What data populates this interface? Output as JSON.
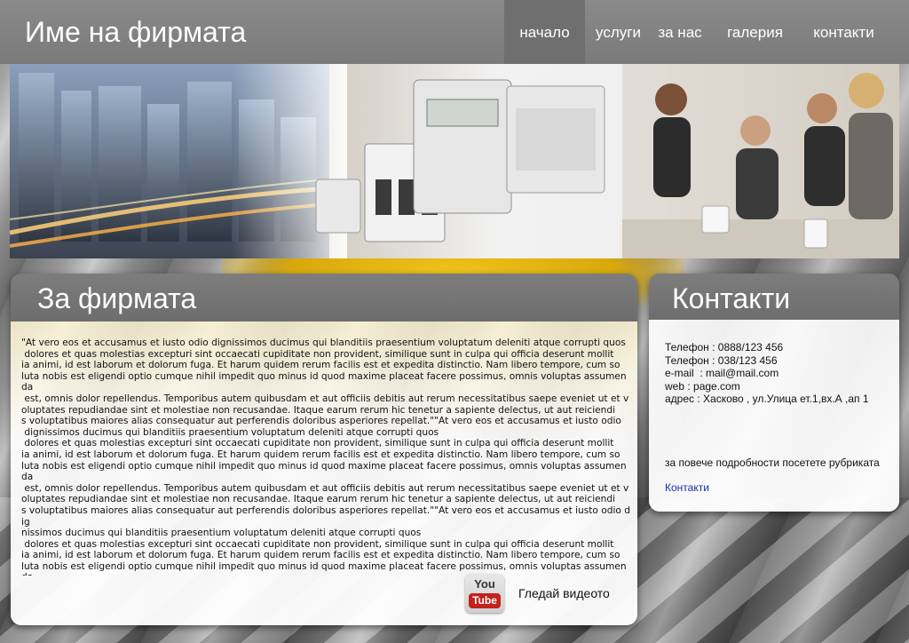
{
  "header": {
    "company_name": "Име на фирмата",
    "nav": [
      {
        "label": "начало",
        "active": true
      },
      {
        "label": "услуги",
        "active": false
      },
      {
        "label": "за нас",
        "active": false
      },
      {
        "label": "галерия",
        "active": false
      },
      {
        "label": "контакти",
        "active": false
      }
    ]
  },
  "about": {
    "title": "За фирмата",
    "text": "\"At vero eos et accusamus et iusto odio dignissimos ducimus qui blanditiis praesentium voluptatum deleniti atque corrupti quos\n dolores et quas molestias excepturi sint occaecati cupiditate non provident, similique sunt in culpa qui officia deserunt mollit\nia animi, id est laborum et dolorum fuga. Et harum quidem rerum facilis est et expedita distinctio. Nam libero tempore, cum so\nluta nobis est eligendi optio cumque nihil impedit quo minus id quod maxime placeat facere possimus, omnis voluptas assumenda\n est, omnis dolor repellendus. Temporibus autem quibusdam et aut officiis debitis aut rerum necessitatibus saepe eveniet ut et v\noluptates repudiandae sint et molestiae non recusandae. Itaque earum rerum hic tenetur a sapiente delectus, ut aut reiciendi\ns voluptatibus maiores alias consequatur aut perferendis doloribus asperiores repellat.\"\"At vero eos et accusamus et iusto odio\n dignissimos ducimus qui blanditiis praesentium voluptatum deleniti atque corrupti quos\n dolores et quas molestias excepturi sint occaecati cupiditate non provident, similique sunt in culpa qui officia deserunt mollit\nia animi, id est laborum et dolorum fuga. Et harum quidem rerum facilis est et expedita distinctio. Nam libero tempore, cum so\nluta nobis est eligendi optio cumque nihil impedit quo minus id quod maxime placeat facere possimus, omnis voluptas assumenda\n est, omnis dolor repellendus. Temporibus autem quibusdam et aut officiis debitis aut rerum necessitatibus saepe eveniet ut et v\noluptates repudiandae sint et molestiae non recusandae. Itaque earum rerum hic tenetur a sapiente delectus, ut aut reiciendi\ns voluptatibus maiores alias consequatur aut perferendis doloribus asperiores repellat.\"\"At vero eos et accusamus et iusto odio dig\nnissimos ducimus qui blanditiis praesentium voluptatum deleniti atque corrupti quos\n dolores et quas molestias excepturi sint occaecati cupiditate non provident, similique sunt in culpa qui officia deserunt mollit\nia animi, id est laborum et dolorum fuga. Et harum quidem rerum facilis est et expedita distinctio. Nam libero tempore, cum so\nluta nobis est eligendi optio cumque nihil impedit quo minus id quod maxime placeat facere possimus, omnis voluptas assumenda\n est, omnis dolor repellendus. Temporibus autem quibusdam et aut officiis debitis aut rerum necessitatibus saepe eveniet ut et v\noluptates repudiandae sint et molestiae non recusandae. Itaque earum rerum hic tenetur a sapiente delectus, ut aut reiciendi\ns voluptatibus maiores alias consequatur aut perferendis doloribus asperiores repellat.\"",
    "video_icon_you": "You",
    "video_icon_tube": "Tube",
    "video_label": "Гледай видеото",
    "video_icon": "youtube-icon"
  },
  "contacts": {
    "title": "Контакти",
    "lines": [
      "Телефон : 0888/123 456",
      "Телефон : 038/123 456",
      "e-mail  : mail@mail.com",
      "web : page.com",
      "адрес : Хасково , ул.Улица ет.1,вх.А ,ап 1"
    ],
    "more_text": "за повече подробности посетете рубриката",
    "link_label": "Контакти"
  },
  "colors": {
    "header_bg": "#7f7f7f",
    "active_nav_bg": "#6f6f6f",
    "link": "#1c2fb0",
    "youtube_red": "#c4211c"
  }
}
